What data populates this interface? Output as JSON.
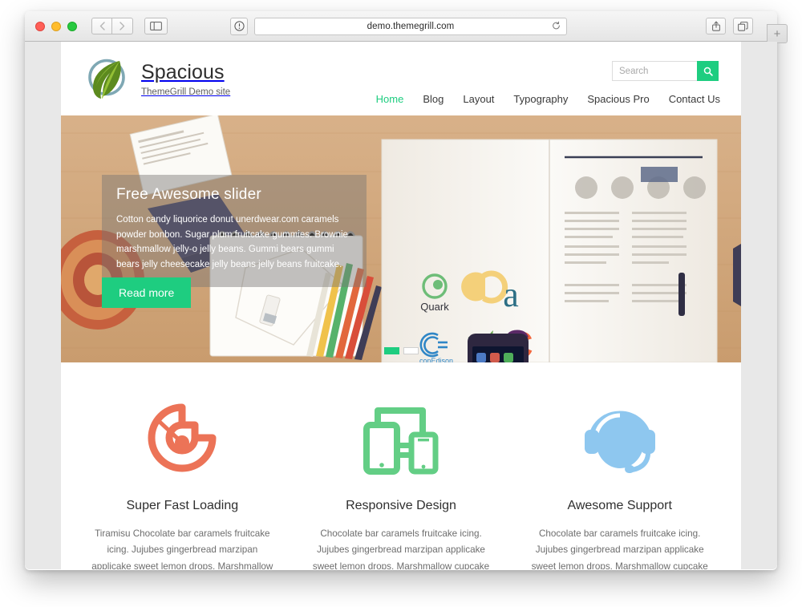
{
  "browser": {
    "url": "demo.themegrill.com",
    "back_label": "‹",
    "forward_label": "›",
    "sidebar_icon": "sidebar-icon",
    "shield_icon": "info-shield-icon",
    "reload_icon": "reload-icon",
    "share_icon": "share-icon",
    "tabs_icon": "show-tabs-icon",
    "new_tab_label": "+",
    "traffic_lights": [
      "close",
      "minimize",
      "zoom"
    ]
  },
  "site": {
    "title": "Spacious",
    "description": "ThemeGrill Demo site",
    "logo_icon": "leaf-logo-icon"
  },
  "search": {
    "placeholder": "Search",
    "value": "",
    "button_icon": "search-icon"
  },
  "nav": {
    "items": [
      {
        "label": "Home",
        "active": true
      },
      {
        "label": "Blog",
        "active": false
      },
      {
        "label": "Layout",
        "active": false
      },
      {
        "label": "Typography",
        "active": false
      },
      {
        "label": "Spacious Pro",
        "active": false
      },
      {
        "label": "Contact Us",
        "active": false
      }
    ]
  },
  "slider": {
    "title": "Free Awesome slider",
    "description": "Cotton candy liquorice donut unerdwear.com caramels powder bonbon. Sugar plum fruitcake gummies. Brownie marshmallow jelly-o jelly beans. Gummi bears gummi bears jelly cheesecake jelly beans jelly beans fruitcake.",
    "button_label": "Read more",
    "slides_total": 2,
    "active_slide": 1,
    "image_description": "Open magazine spread with brand logos, smartphone, notebook and coloured pencils on a wooden desk"
  },
  "features": [
    {
      "icon": "speedometer-icon",
      "color": "#ec7357",
      "title": "Super Fast Loading",
      "text": "Tiramisu Chocolate bar caramels fruitcake icing. Jujubes gingerbread marzipan applicake sweet lemon drops. Marshmallow cupcake bear claw oat cake candy marzipan. Cookie soufflé bear claw."
    },
    {
      "icon": "responsive-devices-icon",
      "color": "#63ce85",
      "title": "Responsive Design",
      "text": "Chocolate bar caramels fruitcake icing. Jujubes gingerbread marzipan applicake sweet lemon drops. Marshmallow cupcake bear claw oat cake candy marzipan. Cookie soufflé bear claw."
    },
    {
      "icon": "headset-support-icon",
      "color": "#8ec7ef",
      "title": "Awesome Support",
      "text": "Chocolate bar caramels fruitcake icing. Jujubes gingerbread marzipan applicake sweet lemon drops. Marshmallow cupcake bear claw oat cake candy marzipan. Cookie soufflé bear claw."
    }
  ],
  "colors": {
    "accent_green": "#1ecd80",
    "icon_orange": "#ec7357",
    "icon_green": "#63ce85",
    "icon_blue": "#8ec7ef"
  }
}
